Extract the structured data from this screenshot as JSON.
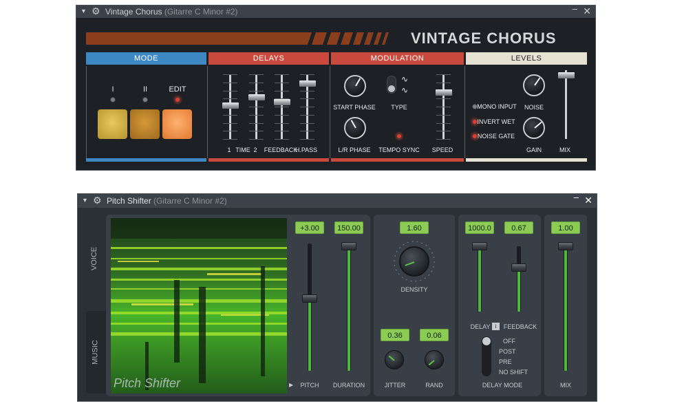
{
  "vintage_chorus": {
    "window": {
      "title": "Vintage Chorus",
      "subtitle": "(Gitarre C Minor #2)",
      "minimize": "‒",
      "close": "✕"
    },
    "logo": "VINTAGE CHORUS",
    "sections": {
      "mode": {
        "label": "MODE",
        "color": "#3d87c2"
      },
      "delays": {
        "label": "DELAYS",
        "color": "#c94a3c"
      },
      "modulation": {
        "label": "MODULATION",
        "color": "#c94a3c"
      },
      "levels": {
        "label": "LEVELS",
        "color": "#e5e1d3"
      }
    },
    "mode": {
      "buttons": [
        {
          "label": "I",
          "led": "off",
          "pad_color": "#d9b44a"
        },
        {
          "label": "II",
          "led": "off",
          "pad_color": "#c58a2a"
        },
        {
          "label": "EDIT",
          "led": "on",
          "pad_color": "#f2944a"
        }
      ]
    },
    "delays": {
      "labels": [
        "1",
        "TIME",
        "2",
        "FEEDBACK",
        "H.PASS"
      ],
      "levels": [
        0.52,
        0.66,
        0.58,
        0.9
      ]
    },
    "modulation": {
      "start_phase_label": "START PHASE",
      "lr_phase_label": "L/R PHASE",
      "type_label": "TYPE",
      "tempo_sync_label": "TEMPO SYNC",
      "speed_label": "SPEED",
      "speed_level": 0.74,
      "tempo_sync_on": true
    },
    "levels": {
      "options": [
        {
          "label": "MONO INPUT",
          "on": false
        },
        {
          "label": "INVERT WET",
          "on": true
        },
        {
          "label": "NOISE GATE",
          "on": true
        }
      ],
      "noise_label": "NOISE",
      "gain_label": "GAIN",
      "mix_label": "MIX",
      "mix_level": 0.97
    }
  },
  "pitch_shifter": {
    "window": {
      "title": "Pitch Shifter",
      "subtitle": "(Gitarre C Minor #2)",
      "minimize": "‒",
      "close": "✕"
    },
    "tabs": [
      "VOICE",
      "MUSIC"
    ],
    "active_tab": "MUSIC",
    "spectrogram_label": "Pitch Shifter",
    "pitch": {
      "value": "+3.00",
      "label": "PITCH",
      "level": 0.57
    },
    "duration": {
      "value": "150.00",
      "label": "DURATION",
      "level": 1.0
    },
    "density": {
      "value": "1.60",
      "label": "DENSITY"
    },
    "jitter": {
      "value": "0.36",
      "label": "JITTER"
    },
    "rand": {
      "value": "0.06",
      "label": "RAND"
    },
    "delay": {
      "value": "1000.0",
      "level": 1.0
    },
    "feedback": {
      "value": "0.67",
      "level": 0.67
    },
    "delay_toggle": {
      "left": "DELAY",
      "right": "FEEDBACK",
      "icon": "i"
    },
    "delay_mode": {
      "label": "DELAY MODE",
      "options": [
        "OFF",
        "POST",
        "PRE",
        "NO SHIFT"
      ],
      "selected": "OFF"
    },
    "mix": {
      "value": "1.00",
      "label": "MIX",
      "level": 1.0
    }
  }
}
